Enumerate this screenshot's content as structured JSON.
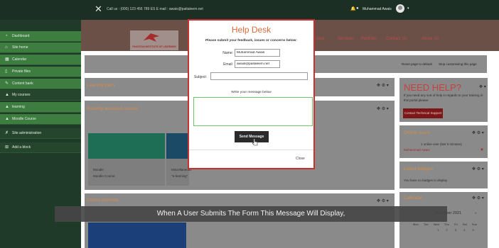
{
  "topbar": {
    "contact": "Call us : (000) 123 456 789 ES E mail : awais@paitaleem.net",
    "user_name": "Muhammad Awais"
  },
  "sidebar": {
    "items": [
      {
        "label": "Dashboard",
        "icon": "dashboard-icon"
      },
      {
        "label": "Site home",
        "icon": "home-icon"
      },
      {
        "label": "Calendar",
        "icon": "calendar-icon"
      },
      {
        "label": "Private files",
        "icon": "file-icon"
      },
      {
        "label": "Content bank",
        "icon": "pencil-icon"
      },
      {
        "label": "My courses",
        "icon": "graduation-icon"
      },
      {
        "label": "learning",
        "icon": "graduation-icon"
      },
      {
        "label": "Moodle Course",
        "icon": "graduation-icon"
      },
      {
        "label": "Site administration",
        "icon": "wrench-icon"
      },
      {
        "label": "Add a block",
        "icon": "plus-square-icon"
      }
    ]
  },
  "header": {
    "logo_text": "PAKISTAN INSTITUTE OF LEARNING",
    "nav": [
      "...lace",
      "Services",
      "Portfolio",
      "Contact Us",
      "About Us"
    ]
  },
  "page": {
    "reset_label": "Reset page to default",
    "stop_label": "Stop customising this page",
    "learning_plans": "Learning plans",
    "recent_courses": "Recently accessed courses",
    "course_overview": "Course overview",
    "tiles": [
      {
        "category": "Moodle",
        "name": "Moodle Course"
      },
      {
        "category": "Miscellaneous",
        "name": "\"e-learning\""
      }
    ]
  },
  "right": {
    "need_help_title": "NEED HELP?",
    "need_help_desc": "If you need any sort of help in regards to your training in this portal please:",
    "support_button": "Contact Technical Support",
    "online_users_title": "Online users",
    "online_users_info": "1 online user (last 5 minutes)",
    "online_user_name": "Muhammad Awais",
    "latest_badges_title": "Latest badges",
    "latest_badges_info": "You have no badges to display",
    "calendar_title": "Calendar",
    "calendar_month": "December 2021",
    "calendar_days": [
      "Mon",
      "Tue",
      "Wed",
      "Thu",
      "Fri",
      "Sat",
      "Sun"
    ],
    "calendar_week1": [
      "",
      "",
      "1",
      "2",
      "3",
      "4",
      "5"
    ]
  },
  "modal": {
    "title": "Help Desk",
    "subtitle": "Please submit your feedback, issues or concerns below:",
    "name_label": "Name:",
    "name_value": "Muhammad Awais",
    "email_label": "Email:",
    "email_value": "awais@paitaleem.net",
    "subject_label": "Subject:",
    "subject_value": "",
    "message_label": "Write your message below",
    "message_value": "",
    "send_label": "Send Message",
    "close_label": "Close"
  },
  "caption": "When A User Submits The Form This Message Will Display,",
  "colors": {
    "accent": "#c93030",
    "title_orange": "#d96b3a",
    "sidebar_green": "#3d7d40",
    "topbar": "#1b2f24"
  }
}
